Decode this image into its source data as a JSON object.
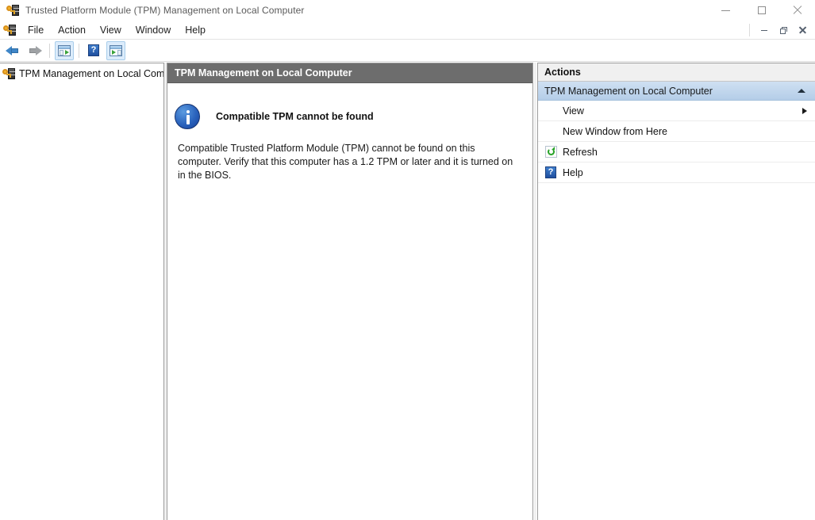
{
  "window": {
    "title": "Trusted Platform Module (TPM) Management on Local Computer",
    "icon": "tpm-key-chip-icon",
    "controls": {
      "minimize": "minimize",
      "maximize": "maximize",
      "close": "close"
    }
  },
  "menubar": {
    "icon": "tpm-key-chip-icon",
    "items": [
      {
        "label": "File"
      },
      {
        "label": "Action"
      },
      {
        "label": "View"
      },
      {
        "label": "Window"
      },
      {
        "label": "Help"
      }
    ],
    "mdi_controls": {
      "minimize": "minimize",
      "restore": "restore",
      "close": "close"
    }
  },
  "toolbar": {
    "items": [
      {
        "name": "back-button",
        "icon": "arrow-left-icon",
        "enabled": true
      },
      {
        "name": "forward-button",
        "icon": "arrow-right-icon",
        "enabled": false
      },
      {
        "name": "show-hide-console-tree-button",
        "icon": "console-tree-icon",
        "toggled": true
      },
      {
        "name": "help-button",
        "icon": "help-icon",
        "glyph": "?",
        "toggled": false
      },
      {
        "name": "show-hide-action-pane-button",
        "icon": "action-pane-icon",
        "toggled": true
      }
    ]
  },
  "tree": {
    "items": [
      {
        "label": "TPM Management on Local Comp",
        "icon": "tpm-node-icon"
      }
    ]
  },
  "center": {
    "header_title": "TPM Management on Local Computer",
    "info": {
      "icon": "information-icon",
      "title": "Compatible TPM cannot be found",
      "body": "Compatible Trusted Platform Module (TPM) cannot be found on this computer. Verify that this computer has a 1.2 TPM or later and it is turned on in the BIOS."
    }
  },
  "actions": {
    "header_title": "Actions",
    "section": {
      "title": "TPM Management on Local Computer",
      "collapse_icon": "chevron-up-icon"
    },
    "items": [
      {
        "label": "View",
        "icon": null,
        "submenu": true,
        "submenu_icon": "chevron-right-icon"
      },
      {
        "label": "New Window from Here",
        "icon": null,
        "submenu": false
      },
      {
        "label": "Refresh",
        "icon": "refresh-icon",
        "submenu": false
      },
      {
        "label": "Help",
        "icon": "help-icon",
        "glyph": "?",
        "submenu": false
      }
    ]
  },
  "colors": {
    "center_header_bg": "#6d6d6d",
    "actions_section_top": "#cfe0f2",
    "actions_section_bottom": "#b4cde8",
    "info_icon_blue": "#2a63bd",
    "toolbar_toggle_bg": "#dcecfb",
    "refresh_green": "#27a327",
    "help_blue": "#1f4f9e",
    "window_bg": "#ffffff",
    "pane_border": "#9c9c9c"
  }
}
